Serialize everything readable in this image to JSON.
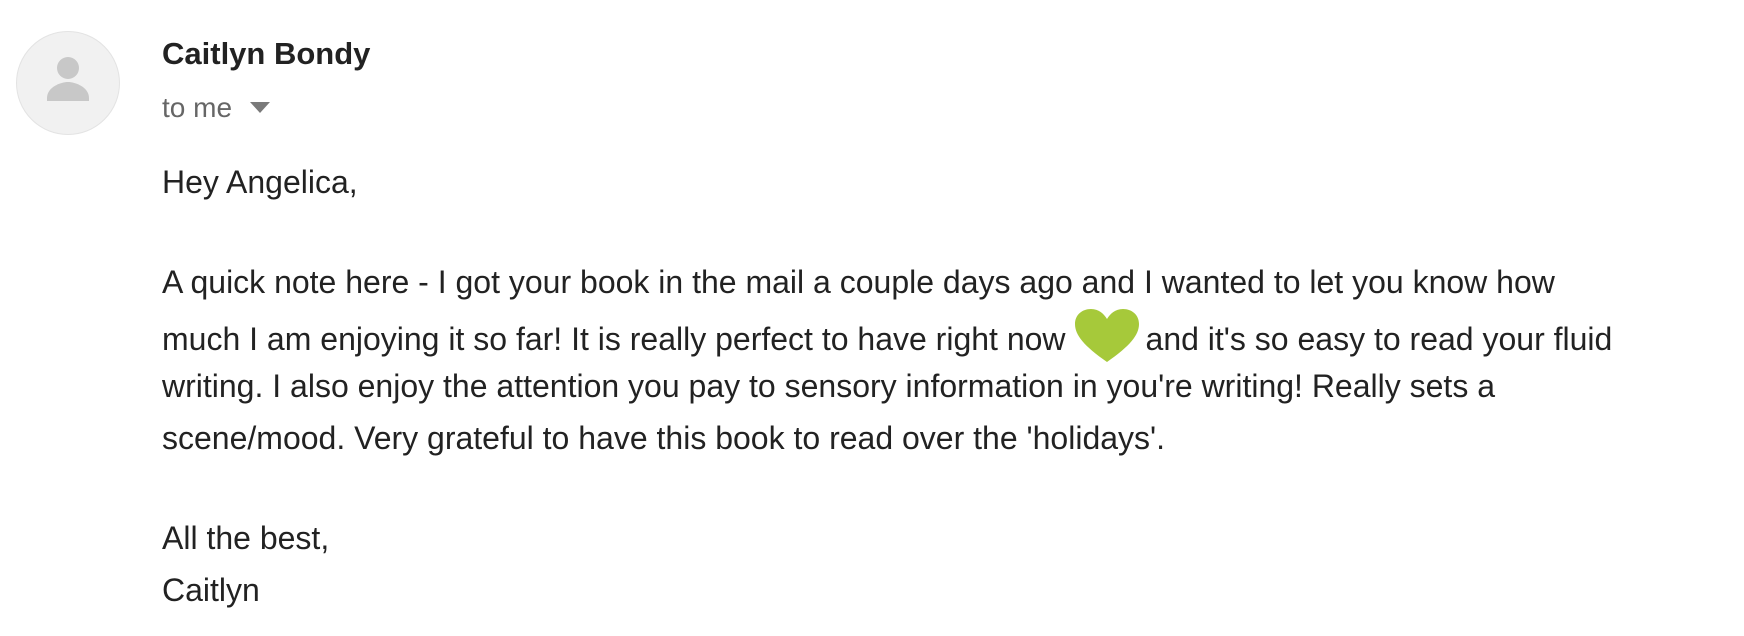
{
  "message": {
    "sender": "Caitlyn Bondy",
    "recipient_label": "to me",
    "avatar_icon": "person-icon",
    "dropdown_icon": "caret-down-icon",
    "body": {
      "greeting": "Hey Angelica,",
      "line1": "A quick note here - I got your book in the mail a couple days ago and I wanted to let you know how",
      "line2_before": "much I am enjoying it so far! It is really perfect to have right now",
      "line2_after": "and it's so easy to read your fluid",
      "line3": "writing. I also enjoy the attention you pay to sensory information in you're writing! Really sets a",
      "line4": "scene/mood. Very grateful to have this book to read over the 'holidays'.",
      "signoff": "All the best,",
      "signature": "Caitlyn"
    },
    "emoji": {
      "name": "green-heart-icon",
      "color": "#a6c93a"
    },
    "colors": {
      "sender": "#222222",
      "recipient": "#666666",
      "avatar_bg": "#f1f1f1",
      "avatar_glyph": "#c8c8c8"
    }
  }
}
